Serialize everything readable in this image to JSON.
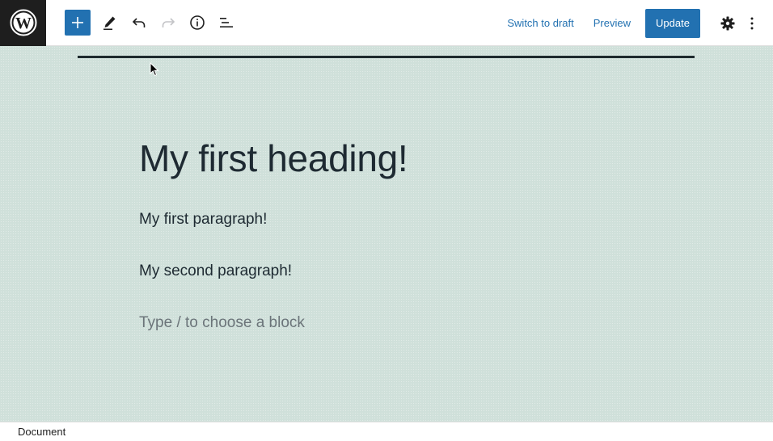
{
  "header": {
    "logo_icon": "wordpress-logo-icon",
    "tools": [
      {
        "name": "add-block",
        "icon": "plus-icon"
      },
      {
        "name": "tools",
        "icon": "pencil-icon"
      },
      {
        "name": "undo",
        "icon": "undo-icon"
      },
      {
        "name": "redo",
        "icon": "redo-icon"
      },
      {
        "name": "details",
        "icon": "info-icon"
      },
      {
        "name": "list-view",
        "icon": "list-view-icon"
      }
    ],
    "switch_to_draft_label": "Switch to draft",
    "preview_label": "Preview",
    "update_label": "Update",
    "settings_icon": "gear-icon",
    "options_icon": "more-vertical-icon"
  },
  "editor": {
    "heading": "My first heading!",
    "paragraph_1": "My first paragraph!",
    "paragraph_2": "My second paragraph!",
    "placeholder": "Type / to choose a block"
  },
  "footer": {
    "breadcrumb": "Document"
  },
  "colors": {
    "accent": "#2271b1",
    "canvas_background": "#cfe0da",
    "logo_background": "#1e1e1e"
  }
}
